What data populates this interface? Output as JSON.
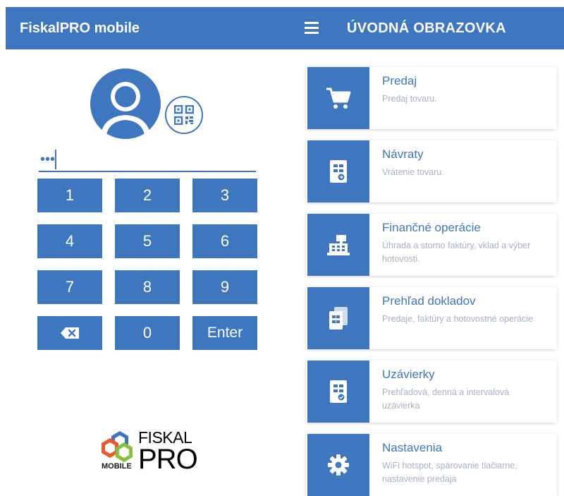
{
  "header": {
    "app_title": "FiskalPRO mobile",
    "page_title": "ÚVODNÁ OBRAZOVKA",
    "menu_icon": "hamburger-menu-icon"
  },
  "login": {
    "avatar_icon": "user-avatar-icon",
    "qr_icon": "qr-code-icon",
    "pin_value": "•••",
    "keys": [
      {
        "label": "1"
      },
      {
        "label": "2"
      },
      {
        "label": "3"
      },
      {
        "label": "4"
      },
      {
        "label": "5"
      },
      {
        "label": "6"
      },
      {
        "label": "7"
      },
      {
        "label": "8"
      },
      {
        "label": "9"
      },
      {
        "label": "",
        "icon": "backspace-icon"
      },
      {
        "label": "0"
      },
      {
        "label": "Enter"
      }
    ]
  },
  "logo": {
    "line1": "FISKAL",
    "line2": "PRO",
    "line3": "MOBILE"
  },
  "menu": {
    "items": [
      {
        "title": "Predaj",
        "description": "Predaj tovaru.",
        "icon": "shopping-cart-icon"
      },
      {
        "title": "Návraty",
        "description": "Vrátenie tovaru.",
        "icon": "return-receipt-icon"
      },
      {
        "title": "Finančné operácie",
        "description": "Úhrada a storno faktúry, vklad a výber hotovosti.",
        "icon": "cash-register-icon"
      },
      {
        "title": "Prehľad dokladov",
        "description": "Predaje, faktúry a hotovostné operácie",
        "icon": "documents-icon"
      },
      {
        "title": "Uzávierky",
        "description": "Prehľadová, denná a intervalová uzávierka",
        "icon": "closure-report-icon"
      },
      {
        "title": "Nastavenia",
        "description": "WiFi hotspot, spárovanie tlačiarne, nastavenie predaja",
        "icon": "gear-icon"
      }
    ]
  },
  "colors": {
    "primary": "#3e77bf",
    "description_text": "#a6b2c4",
    "background": "#ffffff"
  }
}
